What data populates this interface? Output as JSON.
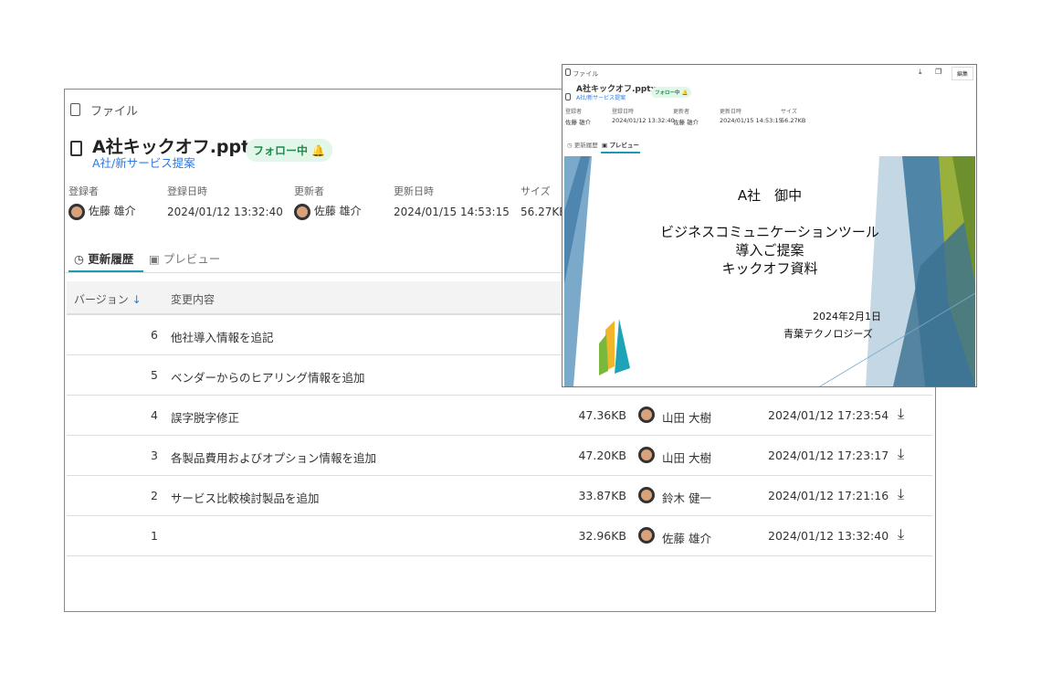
{
  "file": {
    "section_label": "ファイル",
    "name": "A社キックオフ.pptx",
    "folder": "A社/新サービス提案",
    "follow_label": "フォロー中"
  },
  "meta": {
    "registrant_label": "登録者",
    "registrant": "佐藤 雄介",
    "registered_label": "登録日時",
    "registered": "2024/01/12 13:32:40",
    "updater_label": "更新者",
    "updater": "佐藤 雄介",
    "updated_label": "更新日時",
    "updated": "2024/01/15 14:53:15",
    "size_label": "サイズ",
    "size": "56.27KB"
  },
  "tabs": {
    "history": "更新履歴",
    "preview": "プレビュー"
  },
  "table": {
    "col_version": "バージョン",
    "col_change": "変更内容",
    "rows": [
      {
        "version": "6",
        "change": "他社導入情報を追記",
        "size": "",
        "user": "",
        "date": ""
      },
      {
        "version": "5",
        "change": "ベンダーからのヒアリング情報を追加",
        "size": "",
        "user": "",
        "date": ""
      },
      {
        "version": "4",
        "change": "誤字脱字修正",
        "size": "47.36KB",
        "user": "山田 大樹",
        "date": "2024/01/12 17:23:54"
      },
      {
        "version": "3",
        "change": "各製品費用およびオプション情報を追加",
        "size": "47.20KB",
        "user": "山田 大樹",
        "date": "2024/01/12 17:23:17"
      },
      {
        "version": "2",
        "change": "サービス比較検討製品を追加",
        "size": "33.87KB",
        "user": "鈴木 健一",
        "date": "2024/01/12 17:21:16"
      },
      {
        "version": "1",
        "change": "",
        "size": "32.96KB",
        "user": "佐藤 雄介",
        "date": "2024/01/12 13:32:40"
      }
    ]
  },
  "front": {
    "edit_label": "編集"
  },
  "slide": {
    "line1": "A社　御中",
    "line2": "ビジネスコミュニケーションツール",
    "line3": "導入ご提案",
    "line4": "キックオフ資料",
    "date": "2024年2月1日",
    "company": "青葉テクノロジーズ"
  }
}
